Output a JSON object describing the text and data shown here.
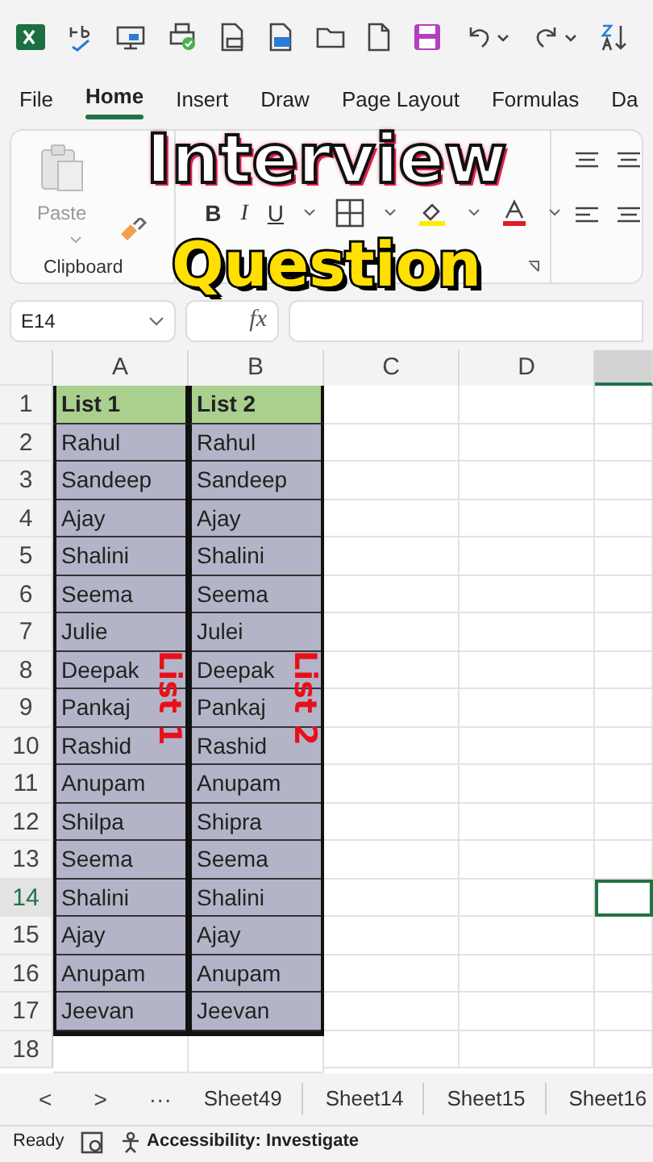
{
  "ribbon_tabs": [
    {
      "label": "File",
      "selected": false
    },
    {
      "label": "Home",
      "selected": true
    },
    {
      "label": "Insert",
      "selected": false
    },
    {
      "label": "Draw",
      "selected": false
    },
    {
      "label": "Page Layout",
      "selected": false
    },
    {
      "label": "Formulas",
      "selected": false
    },
    {
      "label": "Da",
      "selected": false
    }
  ],
  "ribbon": {
    "paste_label": "Paste",
    "group_label": "Clipboard",
    "font_buttons": [
      "B",
      "I",
      "U"
    ]
  },
  "overlay_title": [
    "Interview",
    "Question"
  ],
  "formula_bar": {
    "name_box": "E14",
    "fx": "fx"
  },
  "columns": [
    {
      "label": "A",
      "selected": false
    },
    {
      "label": "B",
      "selected": false
    },
    {
      "label": "C",
      "selected": false
    },
    {
      "label": "D",
      "selected": false
    },
    {
      "selected": true
    }
  ],
  "rows": [
    {
      "number": "1",
      "kind": "header",
      "selected": false,
      "cells": [
        "List 1",
        "List 2"
      ]
    },
    {
      "number": "2",
      "kind": "data",
      "selected": false,
      "cells": [
        "Rahul",
        "Rahul"
      ]
    },
    {
      "number": "3",
      "kind": "data",
      "selected": false,
      "cells": [
        "Sandeep",
        "Sandeep"
      ]
    },
    {
      "number": "4",
      "kind": "data",
      "selected": false,
      "cells": [
        "Ajay",
        "Ajay"
      ]
    },
    {
      "number": "5",
      "kind": "data",
      "selected": false,
      "cells": [
        "Shalini",
        "Shalini"
      ]
    },
    {
      "number": "6",
      "kind": "data",
      "selected": false,
      "cells": [
        "Seema",
        "Seema"
      ]
    },
    {
      "number": "7",
      "kind": "data",
      "selected": false,
      "cells": [
        "Julie",
        "Julei"
      ]
    },
    {
      "number": "8",
      "kind": "data",
      "selected": false,
      "cells": [
        "Deepak",
        "Deepak"
      ]
    },
    {
      "number": "9",
      "kind": "data",
      "selected": false,
      "cells": [
        "Pankaj",
        "Pankaj"
      ]
    },
    {
      "number": "10",
      "kind": "data",
      "selected": false,
      "cells": [
        "Rashid",
        "Rashid"
      ]
    },
    {
      "number": "11",
      "kind": "data",
      "selected": false,
      "cells": [
        "Anupam",
        "Anupam"
      ]
    },
    {
      "number": "12",
      "kind": "data",
      "selected": false,
      "cells": [
        "Shilpa",
        "Shipra"
      ]
    },
    {
      "number": "13",
      "kind": "data",
      "selected": false,
      "cells": [
        "Seema",
        "Seema"
      ]
    },
    {
      "number": "14",
      "kind": "data",
      "selected": true,
      "cells": [
        "Shalini",
        "Shalini"
      ]
    },
    {
      "number": "15",
      "kind": "data",
      "selected": false,
      "cells": [
        "Ajay",
        "Ajay"
      ]
    },
    {
      "number": "16",
      "kind": "data",
      "selected": false,
      "cells": [
        "Anupam",
        "Anupam"
      ]
    },
    {
      "number": "17",
      "kind": "data",
      "selected": false,
      "cells": [
        "Jeevan",
        "Jeevan"
      ]
    },
    {
      "number": "18",
      "kind": "empty",
      "selected": false,
      "cells": []
    }
  ],
  "list_overlays": [
    "List 1",
    "List 2"
  ],
  "sheet_tabs": [
    {
      "label": "Sheet49",
      "selected": false
    },
    {
      "label": "Sheet14",
      "selected": false
    },
    {
      "label": "Sheet15",
      "selected": false
    },
    {
      "label": "Sheet16",
      "selected": false
    }
  ],
  "sheet_nav": [
    "<",
    ">",
    "···"
  ],
  "status_bar": {
    "ready": "Ready",
    "accessibility": "Accessibility: Investigate"
  }
}
